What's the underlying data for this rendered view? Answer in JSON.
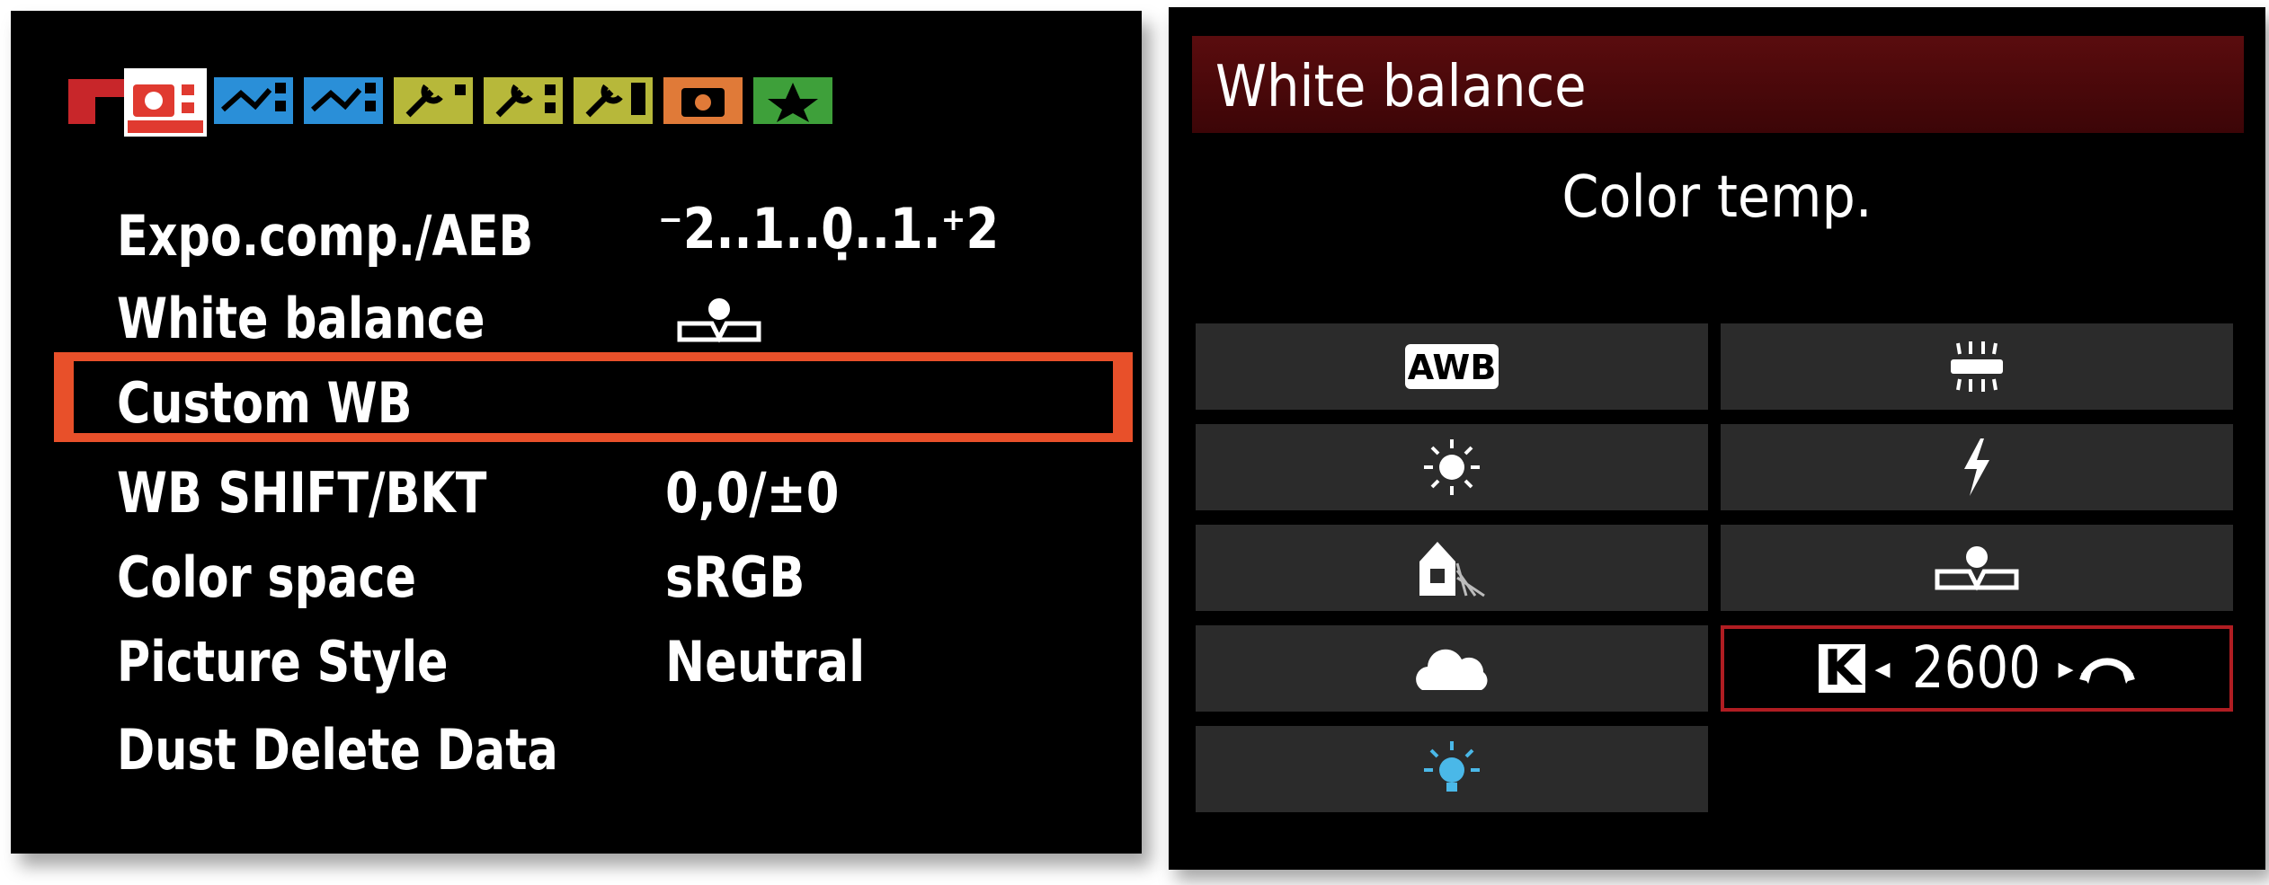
{
  "menu": {
    "tabs": [
      {
        "name": "shooting-1",
        "color": "#c8262a"
      },
      {
        "name": "shooting-2",
        "color": "#e03a30",
        "active": true
      },
      {
        "name": "playback-1",
        "color": "#2a8fd8"
      },
      {
        "name": "playback-2",
        "color": "#2a8fd8"
      },
      {
        "name": "setup-1",
        "color": "#b7b83a"
      },
      {
        "name": "setup-2",
        "color": "#b7b83a"
      },
      {
        "name": "setup-3",
        "color": "#b7b83a"
      },
      {
        "name": "custom-functions",
        "color": "#e07a38"
      },
      {
        "name": "my-menu",
        "color": "#3ea03a"
      }
    ],
    "rows": [
      {
        "label": "Expo.comp./AEB",
        "value": "⁻2..1..0̣..1.⁺2"
      },
      {
        "label": "White balance",
        "value": "custom-wb-icon"
      },
      {
        "label": "Custom WB",
        "value": "",
        "selected": true
      },
      {
        "label": "WB SHIFT/BKT",
        "value": "0,0/±0"
      },
      {
        "label": "Color space",
        "value": "sRGB"
      },
      {
        "label": "Picture Style",
        "value": "Neutral"
      },
      {
        "label": "Dust Delete Data",
        "value": ""
      }
    ]
  },
  "wb": {
    "title": "White balance",
    "subtitle": "Color temp.",
    "options": [
      {
        "icon": "awb-icon",
        "label": "AWB"
      },
      {
        "icon": "fluorescent-icon"
      },
      {
        "icon": "daylight-icon"
      },
      {
        "icon": "flash-icon"
      },
      {
        "icon": "shade-icon"
      },
      {
        "icon": "custom-wb-icon"
      },
      {
        "icon": "cloudy-icon"
      },
      {
        "icon": "color-temp-icon",
        "k_value": "2600",
        "selected": true
      },
      {
        "icon": "tungsten-icon"
      }
    ],
    "k_badge": "K"
  },
  "colors": {
    "highlight": "#e8502a",
    "header": "#4a0a0c",
    "selected_border": "#b01d22",
    "tungsten": "#4ab8e8"
  }
}
